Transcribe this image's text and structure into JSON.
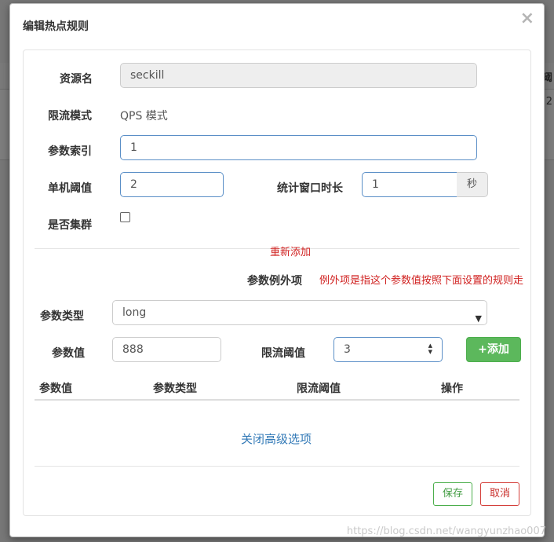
{
  "dialog": {
    "title": "编辑热点规则",
    "close_glyph": "×"
  },
  "background": {
    "fragment_1": "阈",
    "fragment_2": "2"
  },
  "form": {
    "resource_name_label": "资源名",
    "resource_name_value": "seckill",
    "limit_mode_label": "限流模式",
    "limit_mode_value": "QPS 模式",
    "param_index_label": "参数索引",
    "param_index_value": "1",
    "threshold_label": "单机阈值",
    "threshold_value": "2",
    "window_label": "统计窗口时长",
    "window_value": "1",
    "window_unit": "秒",
    "cluster_label": "是否集群",
    "cluster_checked": false
  },
  "exceptions": {
    "readd_link": "重新添加",
    "section_label": "参数例外项",
    "section_hint": "例外项是指这个参数值按照下面设置的规则走",
    "param_type_label": "参数类型",
    "param_type_value": "long",
    "param_value_label": "参数值",
    "param_value_value": "888",
    "limit_threshold_label": "限流阈值",
    "limit_threshold_value": "3",
    "add_button": "添加",
    "table_headers": [
      "参数值",
      "参数类型",
      "限流阈值",
      "操作"
    ],
    "toggle_advanced": "关闭高级选项"
  },
  "footer": {
    "save_label": "保存",
    "cancel_label": "取消"
  },
  "watermark": "https://blog.csdn.net/wangyunzhao007",
  "colors": {
    "accent_blue": "#337ab7",
    "success_green": "#5cb85c",
    "danger_red": "#d0201f"
  }
}
